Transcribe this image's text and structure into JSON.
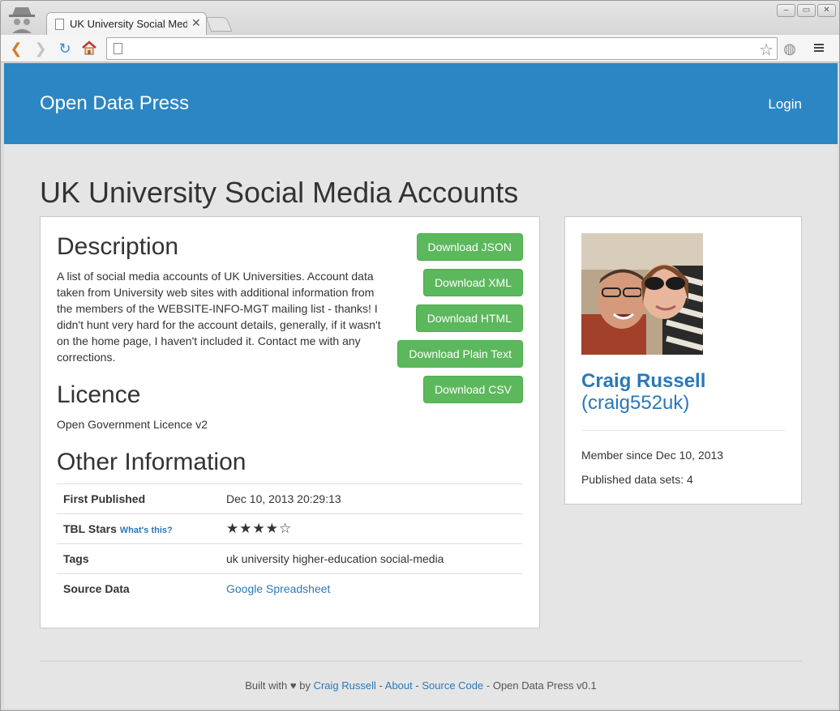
{
  "browser": {
    "tab_title": "UK University Social Media Accounts",
    "tab_close": "✕",
    "url": ""
  },
  "site": {
    "brand": "Open Data Press",
    "login": "Login"
  },
  "page": {
    "title": "UK University Social Media Accounts",
    "description_heading": "Description",
    "description": "A list of social media accounts of UK Universities. Account data taken from University web sites with additional information from the members of the WEBSITE-INFO-MGT mailing list - thanks! I didn't hunt very hard for the account details, generally, if it wasn't on the home page, I haven't included it. Contact me with any corrections.",
    "licence_heading": "Licence",
    "licence": "Open Government Licence v2",
    "other_heading": "Other Information"
  },
  "downloads": [
    {
      "label": "Download JSON"
    },
    {
      "label": "Download XML"
    },
    {
      "label": "Download HTML"
    },
    {
      "label": "Download Plain Text"
    },
    {
      "label": "Download CSV"
    }
  ],
  "info": {
    "first_published_label": "First Published",
    "first_published_value": "Dec 10, 2013 20:29:13",
    "tbl_stars_label": "TBL Stars",
    "whats_this": "What's this?",
    "tbl_stars_value": "★★★★☆",
    "tbl_stars_rating": 4,
    "tbl_stars_max": 5,
    "tags_label": "Tags",
    "tags_value": "uk university higher-education social-media",
    "source_label": "Source Data",
    "source_value": "Google Spreadsheet"
  },
  "author": {
    "name": "Craig Russell",
    "handle": "(craig552uk)",
    "member_since": "Member since Dec 10, 2013",
    "published": "Published data sets: 4"
  },
  "footer": {
    "built_with": "Built with",
    "by": "by",
    "author_link": "Craig Russell",
    "sep1": "-",
    "about": "About",
    "sep2": "-",
    "source_code": "Source Code",
    "sep3": "-",
    "version": "Open Data Press v0.1"
  },
  "colors": {
    "navbar": "#2c86c3",
    "button": "#5cb85c",
    "link": "#2a78b8"
  }
}
